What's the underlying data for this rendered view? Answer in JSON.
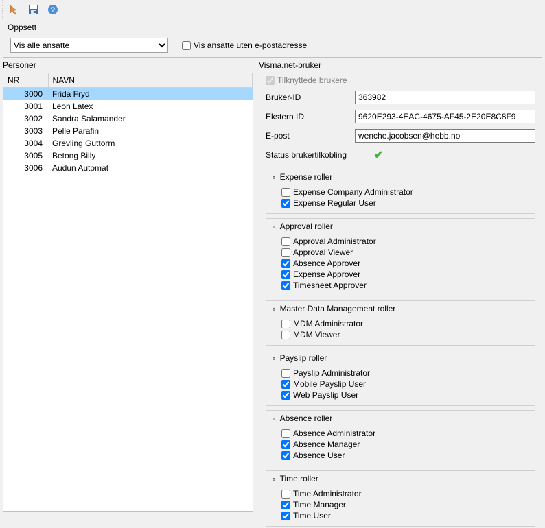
{
  "toolbar": {
    "icons": [
      "pointer-icon",
      "save-icon",
      "help-icon"
    ]
  },
  "oppsett": {
    "title": "Oppsett",
    "dropdown_selected": "Vis alle ansatte",
    "checkbox_label": "Vis ansatte uten e-postadresse",
    "checkbox_checked": false
  },
  "personer": {
    "title": "Personer",
    "columns": {
      "nr": "NR",
      "navn": "NAVN"
    },
    "rows": [
      {
        "nr": "3000",
        "navn": "Frida Fryd",
        "selected": true
      },
      {
        "nr": "3001",
        "navn": "Leon Latex"
      },
      {
        "nr": "3002",
        "navn": "Sandra Salamander"
      },
      {
        "nr": "3003",
        "navn": "Pelle Parafin"
      },
      {
        "nr": "3004",
        "navn": "Grevling Guttorm"
      },
      {
        "nr": "3005",
        "navn": "Betong Billy"
      },
      {
        "nr": "3006",
        "navn": "Audun Automat"
      }
    ]
  },
  "visma": {
    "title": "Visma.net-bruker",
    "tilknyttede_label": "Tilknyttede brukere",
    "tilknyttede_checked": true,
    "fields": {
      "bruker_id_label": "Bruker-ID",
      "bruker_id_value": "363982",
      "ekstern_id_label": "Ekstern ID",
      "ekstern_id_value": "9620E293-4EAC-4675-AF45-2E20E8C8F9",
      "epost_label": "E-post",
      "epost_value": "wenche.jacobsen@hebb.no",
      "status_label": "Status brukertilkobling"
    },
    "role_groups": [
      {
        "title": "Expense roller",
        "roles": [
          {
            "label": "Expense Company Administrator",
            "checked": false
          },
          {
            "label": "Expense Regular User",
            "checked": true
          }
        ]
      },
      {
        "title": "Approval roller",
        "roles": [
          {
            "label": "Approval Administrator",
            "checked": false
          },
          {
            "label": "Approval Viewer",
            "checked": false
          },
          {
            "label": "Absence Approver",
            "checked": true
          },
          {
            "label": "Expense Approver",
            "checked": true
          },
          {
            "label": "Timesheet Approver",
            "checked": true
          }
        ]
      },
      {
        "title": "Master Data Management roller",
        "roles": [
          {
            "label": "MDM Administrator",
            "checked": false
          },
          {
            "label": "MDM Viewer",
            "checked": false
          }
        ]
      },
      {
        "title": "Payslip roller",
        "roles": [
          {
            "label": "Payslip Administrator",
            "checked": false
          },
          {
            "label": "Mobile Payslip User",
            "checked": true
          },
          {
            "label": "Web Payslip User",
            "checked": true
          }
        ]
      },
      {
        "title": "Absence roller",
        "roles": [
          {
            "label": "Absence Administrator",
            "checked": false
          },
          {
            "label": "Absence Manager",
            "checked": true
          },
          {
            "label": "Absence User",
            "checked": true
          }
        ]
      },
      {
        "title": "Time roller",
        "roles": [
          {
            "label": "Time Administrator",
            "checked": false
          },
          {
            "label": "Time Manager",
            "checked": true
          },
          {
            "label": "Time User",
            "checked": true
          }
        ]
      }
    ]
  }
}
